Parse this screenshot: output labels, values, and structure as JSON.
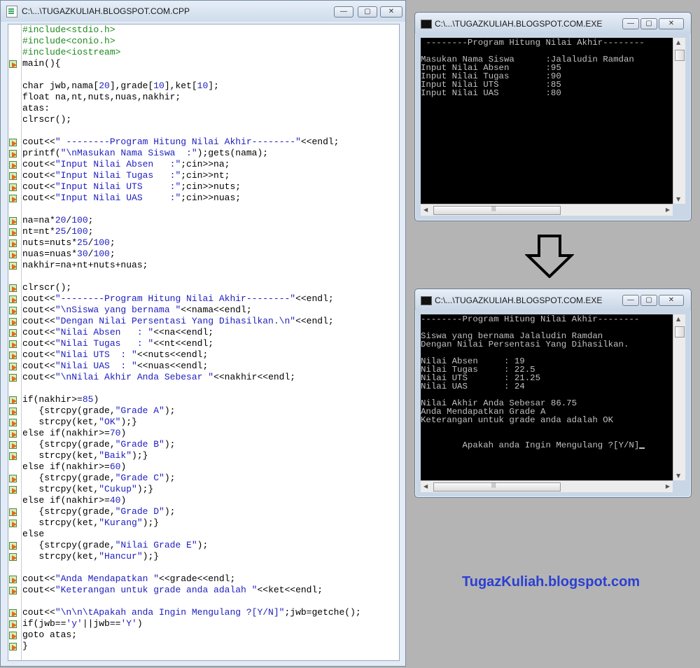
{
  "editor": {
    "title": "C:\\...\\TUGAZKULIAH.BLOGSPOT.COM.CPP",
    "lines": [
      {
        "mark": false,
        "parts": [
          [
            "g",
            "#include<stdio.h>"
          ]
        ]
      },
      {
        "mark": false,
        "parts": [
          [
            "g",
            "#include<conio.h>"
          ]
        ]
      },
      {
        "mark": false,
        "parts": [
          [
            "g",
            "#include<iostream>"
          ]
        ]
      },
      {
        "mark": true,
        "parts": [
          [
            "k",
            "main(){"
          ]
        ]
      },
      {
        "mark": false,
        "parts": []
      },
      {
        "mark": false,
        "parts": [
          [
            "k",
            "char jwb,nama["
          ],
          [
            "n",
            "20"
          ],
          [
            "k",
            "],grade["
          ],
          [
            "n",
            "10"
          ],
          [
            "k",
            "],ket["
          ],
          [
            "n",
            "10"
          ],
          [
            "k",
            "];"
          ]
        ]
      },
      {
        "mark": false,
        "parts": [
          [
            "k",
            "float na,nt,nuts,nuas,nakhir;"
          ]
        ]
      },
      {
        "mark": false,
        "parts": [
          [
            "k",
            "atas:"
          ]
        ]
      },
      {
        "mark": false,
        "parts": [
          [
            "k",
            "clrscr();"
          ]
        ]
      },
      {
        "mark": false,
        "parts": []
      },
      {
        "mark": true,
        "parts": [
          [
            "k",
            "cout<<"
          ],
          [
            "s",
            "\" --------Program Hitung Nilai Akhir--------\""
          ],
          [
            "k",
            "<<endl;"
          ]
        ]
      },
      {
        "mark": true,
        "parts": [
          [
            "k",
            "printf("
          ],
          [
            "s",
            "\"\\nMasukan Nama Siswa  :\""
          ],
          [
            "k",
            ");gets(nama);"
          ]
        ]
      },
      {
        "mark": true,
        "parts": [
          [
            "k",
            "cout<<"
          ],
          [
            "s",
            "\"Input Nilai Absen   :\""
          ],
          [
            "k",
            ";cin>>na;"
          ]
        ]
      },
      {
        "mark": true,
        "parts": [
          [
            "k",
            "cout<<"
          ],
          [
            "s",
            "\"Input Nilai Tugas   :\""
          ],
          [
            "k",
            ";cin>>nt;"
          ]
        ]
      },
      {
        "mark": true,
        "parts": [
          [
            "k",
            "cout<<"
          ],
          [
            "s",
            "\"Input Nilai UTS     :\""
          ],
          [
            "k",
            ";cin>>nuts;"
          ]
        ]
      },
      {
        "mark": true,
        "parts": [
          [
            "k",
            "cout<<"
          ],
          [
            "s",
            "\"Input Nilai UAS     :\""
          ],
          [
            "k",
            ";cin>>nuas;"
          ]
        ]
      },
      {
        "mark": false,
        "parts": []
      },
      {
        "mark": true,
        "parts": [
          [
            "k",
            "na=na*"
          ],
          [
            "n",
            "20"
          ],
          [
            "k",
            "/"
          ],
          [
            "n",
            "100"
          ],
          [
            "k",
            ";"
          ]
        ]
      },
      {
        "mark": true,
        "parts": [
          [
            "k",
            "nt=nt*"
          ],
          [
            "n",
            "25"
          ],
          [
            "k",
            "/"
          ],
          [
            "n",
            "100"
          ],
          [
            "k",
            ";"
          ]
        ]
      },
      {
        "mark": true,
        "parts": [
          [
            "k",
            "nuts=nuts*"
          ],
          [
            "n",
            "25"
          ],
          [
            "k",
            "/"
          ],
          [
            "n",
            "100"
          ],
          [
            "k",
            ";"
          ]
        ]
      },
      {
        "mark": true,
        "parts": [
          [
            "k",
            "nuas=nuas*"
          ],
          [
            "n",
            "30"
          ],
          [
            "k",
            "/"
          ],
          [
            "n",
            "100"
          ],
          [
            "k",
            ";"
          ]
        ]
      },
      {
        "mark": true,
        "parts": [
          [
            "k",
            "nakhir=na+nt+nuts+nuas;"
          ]
        ]
      },
      {
        "mark": false,
        "parts": []
      },
      {
        "mark": true,
        "parts": [
          [
            "k",
            "clrscr();"
          ]
        ]
      },
      {
        "mark": true,
        "parts": [
          [
            "k",
            "cout<<"
          ],
          [
            "s",
            "\"--------Program Hitung Nilai Akhir--------\""
          ],
          [
            "k",
            "<<endl;"
          ]
        ]
      },
      {
        "mark": true,
        "parts": [
          [
            "k",
            "cout<<"
          ],
          [
            "s",
            "\"\\nSiswa yang bernama \""
          ],
          [
            "k",
            "<<nama<<endl;"
          ]
        ]
      },
      {
        "mark": true,
        "parts": [
          [
            "k",
            "cout<<"
          ],
          [
            "s",
            "\"Dengan Nilai Persentasi Yang Dihasilkan.\\n\""
          ],
          [
            "k",
            "<<endl;"
          ]
        ]
      },
      {
        "mark": true,
        "parts": [
          [
            "k",
            "cout<<"
          ],
          [
            "s",
            "\"Nilai Absen   : \""
          ],
          [
            "k",
            "<<na<<endl;"
          ]
        ]
      },
      {
        "mark": true,
        "parts": [
          [
            "k",
            "cout<<"
          ],
          [
            "s",
            "\"Nilai Tugas   : \""
          ],
          [
            "k",
            "<<nt<<endl;"
          ]
        ]
      },
      {
        "mark": true,
        "parts": [
          [
            "k",
            "cout<<"
          ],
          [
            "s",
            "\"Nilai UTS  : \""
          ],
          [
            "k",
            "<<nuts<<endl;"
          ]
        ]
      },
      {
        "mark": true,
        "parts": [
          [
            "k",
            "cout<<"
          ],
          [
            "s",
            "\"Nilai UAS  : \""
          ],
          [
            "k",
            "<<nuas<<endl;"
          ]
        ]
      },
      {
        "mark": true,
        "parts": [
          [
            "k",
            "cout<<"
          ],
          [
            "s",
            "\"\\nNilai Akhir Anda Sebesar \""
          ],
          [
            "k",
            "<<nakhir<<endl;"
          ]
        ]
      },
      {
        "mark": false,
        "parts": []
      },
      {
        "mark": true,
        "parts": [
          [
            "k",
            "if(nakhir>="
          ],
          [
            "n",
            "85"
          ],
          [
            "k",
            ")"
          ]
        ]
      },
      {
        "mark": true,
        "parts": [
          [
            "k",
            "   {strcpy(grade,"
          ],
          [
            "s",
            "\"Grade A\""
          ],
          [
            "k",
            ");"
          ]
        ]
      },
      {
        "mark": true,
        "parts": [
          [
            "k",
            "   strcpy(ket,"
          ],
          [
            "s",
            "\"OK\""
          ],
          [
            "k",
            ");}"
          ]
        ]
      },
      {
        "mark": true,
        "parts": [
          [
            "k",
            "else if(nakhir>="
          ],
          [
            "n",
            "70"
          ],
          [
            "k",
            ")"
          ]
        ]
      },
      {
        "mark": true,
        "parts": [
          [
            "k",
            "   {strcpy(grade,"
          ],
          [
            "s",
            "\"Grade B\""
          ],
          [
            "k",
            ");"
          ]
        ]
      },
      {
        "mark": true,
        "parts": [
          [
            "k",
            "   strcpy(ket,"
          ],
          [
            "s",
            "\"Baik\""
          ],
          [
            "k",
            ");}"
          ]
        ]
      },
      {
        "mark": false,
        "parts": [
          [
            "k",
            "else if(nakhir>="
          ],
          [
            "n",
            "60"
          ],
          [
            "k",
            ")"
          ]
        ]
      },
      {
        "mark": true,
        "parts": [
          [
            "k",
            "   {strcpy(grade,"
          ],
          [
            "s",
            "\"Grade C\""
          ],
          [
            "k",
            ");"
          ]
        ]
      },
      {
        "mark": true,
        "parts": [
          [
            "k",
            "   strcpy(ket,"
          ],
          [
            "s",
            "\"Cukup\""
          ],
          [
            "k",
            ");}"
          ]
        ]
      },
      {
        "mark": false,
        "parts": [
          [
            "k",
            "else if(nakhir>="
          ],
          [
            "n",
            "40"
          ],
          [
            "k",
            ")"
          ]
        ]
      },
      {
        "mark": true,
        "parts": [
          [
            "k",
            "   {strcpy(grade,"
          ],
          [
            "s",
            "\"Grade D\""
          ],
          [
            "k",
            ");"
          ]
        ]
      },
      {
        "mark": true,
        "parts": [
          [
            "k",
            "   strcpy(ket,"
          ],
          [
            "s",
            "\"Kurang\""
          ],
          [
            "k",
            ");}"
          ]
        ]
      },
      {
        "mark": false,
        "parts": [
          [
            "k",
            "else"
          ]
        ]
      },
      {
        "mark": true,
        "parts": [
          [
            "k",
            "   {strcpy(grade,"
          ],
          [
            "s",
            "\"Nilai Grade E\""
          ],
          [
            "k",
            ");"
          ]
        ]
      },
      {
        "mark": true,
        "parts": [
          [
            "k",
            "   strcpy(ket,"
          ],
          [
            "s",
            "\"Hancur\""
          ],
          [
            "k",
            ");}"
          ]
        ]
      },
      {
        "mark": false,
        "parts": []
      },
      {
        "mark": true,
        "parts": [
          [
            "k",
            "cout<<"
          ],
          [
            "s",
            "\"Anda Mendapatkan \""
          ],
          [
            "k",
            "<<grade<<endl;"
          ]
        ]
      },
      {
        "mark": true,
        "parts": [
          [
            "k",
            "cout<<"
          ],
          [
            "s",
            "\"Keterangan untuk grade anda adalah \""
          ],
          [
            "k",
            "<<ket<<endl;"
          ]
        ]
      },
      {
        "mark": false,
        "parts": []
      },
      {
        "mark": true,
        "parts": [
          [
            "k",
            "cout<<"
          ],
          [
            "s",
            "\"\\n\\n\\tApakah anda Ingin Mengulang ?[Y/N]\""
          ],
          [
            "k",
            ";jwb=getche();"
          ]
        ]
      },
      {
        "mark": true,
        "parts": [
          [
            "k",
            "if(jwb=="
          ],
          [
            "s",
            "'y'"
          ],
          [
            "k",
            "||jwb=="
          ],
          [
            "s",
            "'Y'"
          ],
          [
            "k",
            ")"
          ]
        ]
      },
      {
        "mark": true,
        "parts": [
          [
            "k",
            "goto atas;"
          ]
        ]
      },
      {
        "mark": true,
        "parts": [
          [
            "k",
            "}"
          ]
        ]
      }
    ]
  },
  "console_input": {
    "title": "C:\\...\\TUGAZKULIAH.BLOGSPOT.COM.EXE",
    "text": " --------Program Hitung Nilai Akhir--------\n\nMasukan Nama Siswa      :Jalaludin Ramdan\nInput Nilai Absen       :95\nInput Nilai Tugas       :90\nInput Nilai UTS         :85\nInput Nilai UAS         :80"
  },
  "console_output": {
    "title": "C:\\...\\TUGAZKULIAH.BLOGSPOT.COM.EXE",
    "text": "--------Program Hitung Nilai Akhir--------\n\nSiswa yang bernama Jalaludin Ramdan\nDengan Nilai Persentasi Yang Dihasilkan.\n\nNilai Absen     : 19\nNilai Tugas     : 22.5\nNilai UTS       : 21.25\nNilai UAS       : 24\n\nNilai Akhir Anda Sebesar 86.75\nAnda Mendapatkan Grade A\nKeterangan untuk grade anda adalah OK\n\n\n        Apakah anda Ingin Mengulang ?[Y/N]"
  },
  "window_controls": {
    "minimize": "—",
    "maximize": "▢",
    "close": "✕"
  },
  "scroll_arrows": {
    "up": "▲",
    "down": "▼",
    "left": "◀",
    "right": "▶"
  },
  "thumb_grip": "|||",
  "watermark": "TugazKuliah.blogspot.com",
  "colors": {
    "string": "#1d1dbf",
    "preprocessor": "#1d8a1d",
    "watermark": "#2b3fd1"
  }
}
